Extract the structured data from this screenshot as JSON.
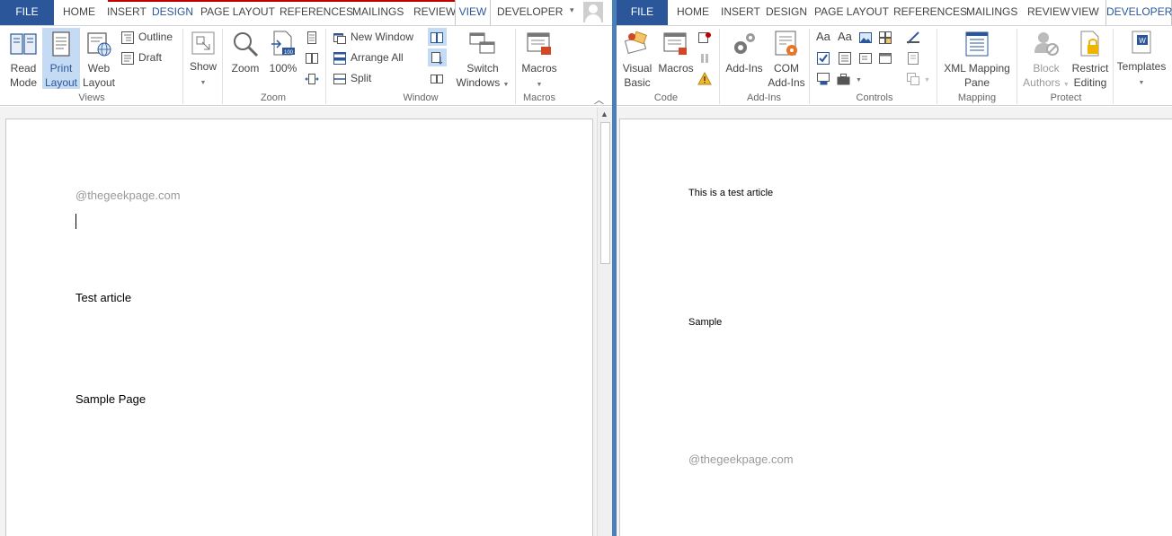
{
  "left_window": {
    "tabs": [
      "FILE",
      "HOME",
      "INSERT",
      "DESIGN",
      "PAGE LAYOUT",
      "REFERENCES",
      "MAILINGS",
      "REVIEW",
      "VIEW",
      "DEVELOPER"
    ],
    "active_tab": "VIEW",
    "groups": {
      "views": {
        "label": "Views",
        "read_mode": [
          "Read",
          "Mode"
        ],
        "print_layout": [
          "Print",
          "Layout"
        ],
        "web_layout": [
          "Web",
          "Layout"
        ],
        "outline": "Outline",
        "draft": "Draft"
      },
      "show": {
        "label": "Show"
      },
      "zoom": {
        "label": "Zoom",
        "zoom": "Zoom",
        "hundred": "100%"
      },
      "window": {
        "label": "Window",
        "new_window": "New Window",
        "arrange_all": "Arrange All",
        "split": "Split",
        "switch_windows": [
          "Switch",
          "Windows"
        ]
      },
      "macros": {
        "label": "Macros",
        "macros": "Macros"
      }
    },
    "document": {
      "watermark": "@thegeekpage.com",
      "line1": "Test article",
      "line2": "Sample Page"
    }
  },
  "right_window": {
    "tabs": [
      "FILE",
      "HOME",
      "INSERT",
      "DESIGN",
      "PAGE LAYOUT",
      "REFERENCES",
      "MAILINGS",
      "REVIEW",
      "VIEW",
      "DEVELOPER"
    ],
    "active_tab": "DEVELOPER",
    "groups": {
      "code": {
        "label": "Code",
        "visual_basic": [
          "Visual",
          "Basic"
        ],
        "macros": "Macros"
      },
      "addins": {
        "label": "Add-Ins",
        "addins": "Add-Ins",
        "com_addins": [
          "COM",
          "Add-Ins"
        ]
      },
      "controls": {
        "label": "Controls",
        "aa1": "Aa",
        "aa2": "Aa"
      },
      "mapping": {
        "label": "Mapping",
        "xml_mapping": [
          "XML Mapping",
          "Pane"
        ]
      },
      "protect": {
        "label": "Protect",
        "block_authors": [
          "Block",
          "Authors"
        ],
        "restrict_editing": [
          "Restrict",
          "Editing"
        ]
      },
      "templates": {
        "templates": "Templates"
      }
    },
    "document": {
      "line1": "This is a test article",
      "line2": "Sample",
      "watermark": "@thegeekpage.com"
    }
  },
  "colors": {
    "file_tab": "#2b579a",
    "active_tab_text": "#2b579a",
    "selected_button": "#c5dbf3",
    "window_divider": "#4b7fba"
  }
}
